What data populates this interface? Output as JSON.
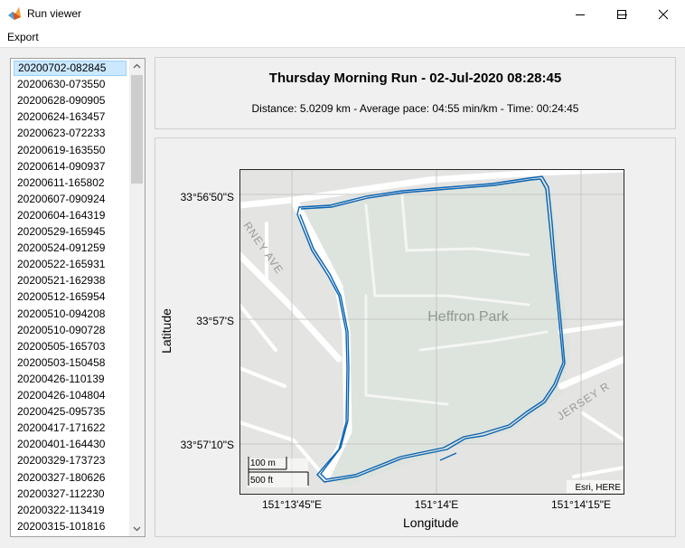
{
  "window": {
    "title": "Run viewer",
    "icon": "matlab-icon"
  },
  "window_controls": {
    "minimize_icon": "minimize-icon",
    "maximize_icon": "maximize-icon",
    "close_icon": "close-icon"
  },
  "menu": {
    "export_label": "Export"
  },
  "runs_list": {
    "selected_index": 0,
    "items": [
      "20200702-082845",
      "20200630-073550",
      "20200628-090905",
      "20200624-163457",
      "20200623-072233",
      "20200619-163550",
      "20200614-090937",
      "20200611-165802",
      "20200607-090924",
      "20200604-164319",
      "20200529-165945",
      "20200524-091259",
      "20200522-165931",
      "20200521-162938",
      "20200512-165954",
      "20200510-094208",
      "20200510-090728",
      "20200505-165703",
      "20200503-150458",
      "20200426-110139",
      "20200426-104804",
      "20200425-095735",
      "20200417-171622",
      "20200401-164430",
      "20200329-173723",
      "20200327-180626",
      "20200327-112230",
      "20200322-113419",
      "20200315-101816"
    ]
  },
  "header": {
    "title": "Thursday Morning Run - 02-Jul-2020 08:28:45",
    "stats": "Distance: 5.0209 km - Average pace: 04:55 min/km - Time: 00:24:45"
  },
  "map": {
    "park_label": "Heffron Park",
    "street_labels": [
      "RNEY AVE",
      "JERSEY R"
    ],
    "attribution": "Esri, HERE",
    "scale_metric": "100 m",
    "scale_imperial": "500 ft",
    "track_color": "#0a64b4",
    "x_label": "Longitude",
    "y_label": "Latitude",
    "x_ticks": [
      "151°13'45\"E",
      "151°14'E",
      "151°14'15\"E"
    ],
    "y_ticks": [
      "33°56'50\"S",
      "33°57'S",
      "33°57'10\"S"
    ]
  }
}
